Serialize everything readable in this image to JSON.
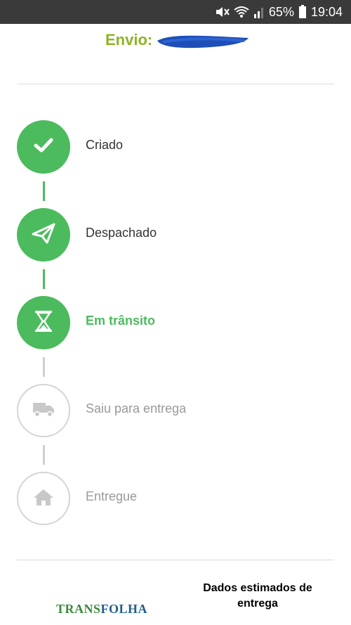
{
  "status_bar": {
    "battery": "65%",
    "time": "19:04",
    "icons": [
      "mute-icon",
      "wifi-icon",
      "signal-icon",
      "battery-icon"
    ]
  },
  "header": {
    "shipment_label": "Envio:",
    "shipment_number_redacted": true,
    "accent_color": "#8cb422"
  },
  "timeline": {
    "steps": [
      {
        "label": "Criado",
        "state": "done",
        "icon": "check-icon"
      },
      {
        "label": "Despachado",
        "state": "done",
        "icon": "paper-plane-icon"
      },
      {
        "label": "Em trânsito",
        "state": "current",
        "icon": "hourglass-icon"
      },
      {
        "label": "Saiu para entrega",
        "state": "pending",
        "icon": "truck-icon"
      },
      {
        "label": "Entregue",
        "state": "pending",
        "icon": "house-icon"
      }
    ],
    "active_color": "#4cbb5e",
    "inactive_color": "#d5d5d5"
  },
  "footer": {
    "logo_part1": "TRANS",
    "logo_part2": "FOLHA",
    "estimate_title": "Dados estimados de entrega"
  }
}
